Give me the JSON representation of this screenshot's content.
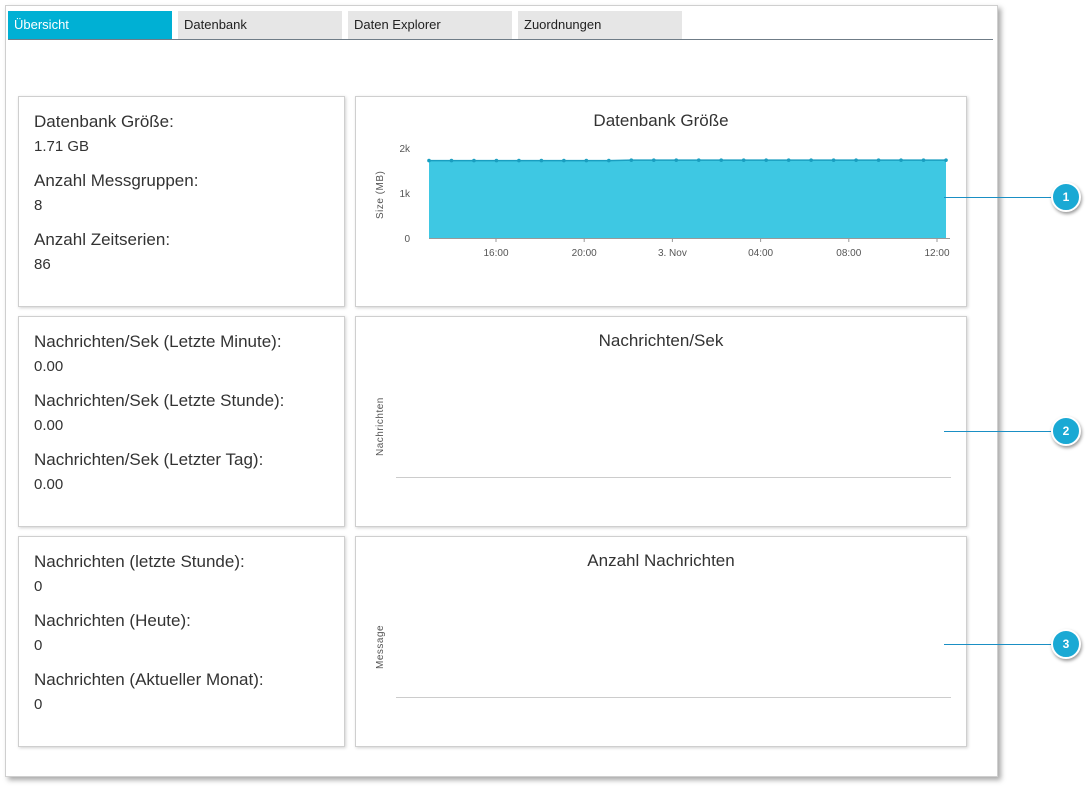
{
  "tabs": [
    {
      "label": "Übersicht",
      "active": true
    },
    {
      "label": "Datenbank",
      "active": false
    },
    {
      "label": "Daten Explorer",
      "active": false
    },
    {
      "label": "Zuordnungen",
      "active": false
    }
  ],
  "stats": {
    "db": [
      {
        "label": "Datenbank Größe:",
        "value": "1.71 GB"
      },
      {
        "label": "Anzahl Messgruppen:",
        "value": "8"
      },
      {
        "label": "Anzahl Zeitserien:",
        "value": "86"
      }
    ],
    "rate": [
      {
        "label": "Nachrichten/Sek (Letzte Minute):",
        "value": "0.00"
      },
      {
        "label": "Nachrichten/Sek (Letzte Stunde):",
        "value": "0.00"
      },
      {
        "label": "Nachrichten/Sek (Letzter Tag):",
        "value": "0.00"
      }
    ],
    "count": [
      {
        "label": "Nachrichten (letzte Stunde):",
        "value": "0"
      },
      {
        "label": "Nachrichten (Heute):",
        "value": "0"
      },
      {
        "label": "Nachrichten (Aktueller Monat):",
        "value": "0"
      }
    ]
  },
  "callouts": [
    "1",
    "2",
    "3"
  ],
  "colors": {
    "accent": "#00b0d4",
    "area": "#3ec8e3",
    "callout": "#1aa9d4"
  },
  "chart_data": [
    {
      "type": "area",
      "title": "Datenbank Größe",
      "ylabel": "Size (MB)",
      "xlabel": "",
      "ylim": [
        0,
        2000
      ],
      "yticks": [
        "2k",
        "1k",
        "0"
      ],
      "xticks": [
        "16:00",
        "20:00",
        "3. Nov",
        "04:00",
        "08:00",
        "12:00"
      ],
      "series": [
        {
          "values": [
            1720,
            1720,
            1720,
            1720,
            1720,
            1720,
            1720,
            1720,
            1720,
            1730,
            1730,
            1730,
            1730,
            1730,
            1730,
            1730,
            1730,
            1730,
            1730,
            1730,
            1730,
            1730,
            1730,
            1730
          ]
        }
      ],
      "grid": false
    },
    {
      "type": "line",
      "title": "Nachrichten/Sek",
      "ylabel": "Nachrichten",
      "series": []
    },
    {
      "type": "line",
      "title": "Anzahl Nachrichten",
      "ylabel": "Message",
      "series": []
    }
  ]
}
